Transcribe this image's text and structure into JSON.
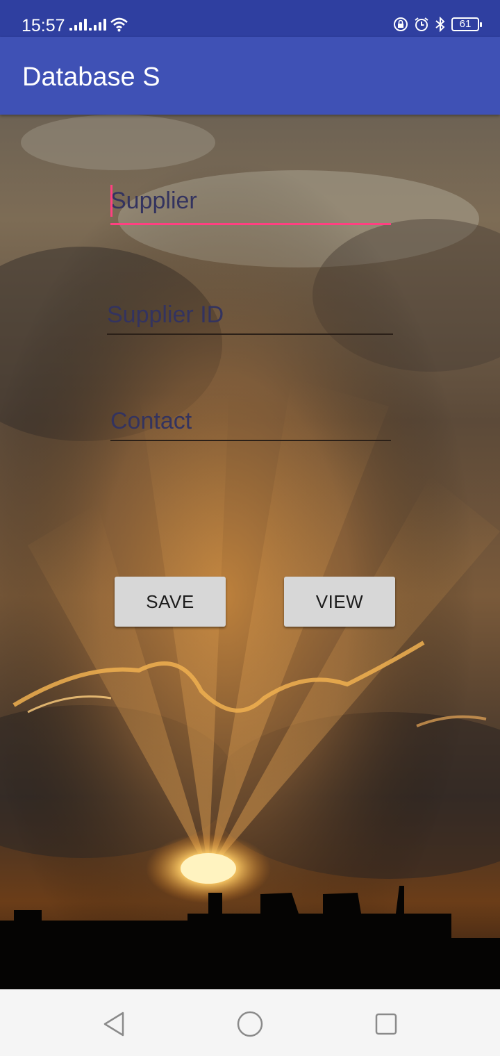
{
  "status_bar": {
    "time": "15:57",
    "battery": "61",
    "icons": [
      "signal-icon",
      "signal-icon",
      "wifi-icon",
      "lock-rotation-icon",
      "alarm-icon",
      "bluetooth-icon",
      "battery-icon"
    ]
  },
  "app_bar": {
    "title": "Database S",
    "color": "#3f51b5"
  },
  "form": {
    "supplier": {
      "placeholder": "Supplier",
      "value": ""
    },
    "supplier_id": {
      "placeholder": "Supplier ID",
      "value": ""
    },
    "contact": {
      "placeholder": "Contact",
      "value": ""
    },
    "accent_color": "#ff4081"
  },
  "buttons": {
    "save": "SAVE",
    "view": "VIEW"
  },
  "nav_bar": {
    "icons": [
      "back-icon",
      "home-icon",
      "recents-icon"
    ]
  }
}
